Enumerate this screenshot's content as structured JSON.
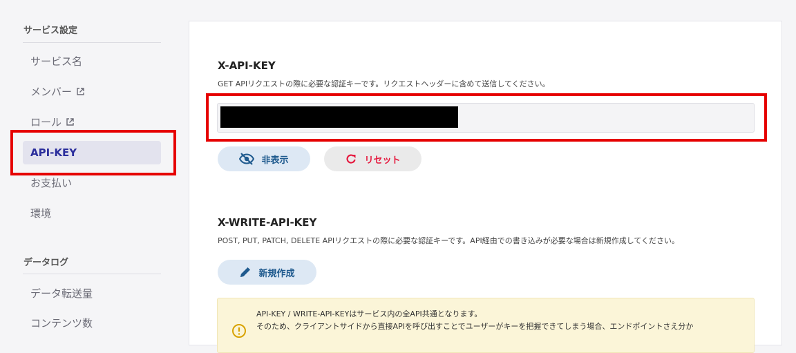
{
  "sidebar": {
    "service_settings_title": "サービス設定",
    "items": [
      {
        "label": "サービス名"
      },
      {
        "label": "メンバー",
        "icon": "external-link-icon"
      },
      {
        "label": "ロール",
        "icon": "external-link-icon"
      },
      {
        "label": "API-KEY",
        "active": true
      },
      {
        "label": "お支払い"
      },
      {
        "label": "環境"
      }
    ],
    "data_log_title": "データログ",
    "data_log_items": [
      {
        "label": "データ転送量"
      },
      {
        "label": "コンテンツ数"
      }
    ]
  },
  "api_key": {
    "title": "X-API-KEY",
    "description": "GET APIリクエストの際に必要な認証キーです。リクエストヘッダーに含めて送信してください。",
    "hide_button": "非表示",
    "reset_button": "リセット"
  },
  "write_api_key": {
    "title": "X-WRITE-API-KEY",
    "description": "POST, PUT, PATCH, DELETE APIリクエストの際に必要な認証キーです。API経由での書き込みが必要な場合は新規作成してください。",
    "create_button": "新規作成"
  },
  "notice": {
    "line1": "API-KEY / WRITE-API-KEYはサービス内の全API共通となります。",
    "line2": "そのため、クライアントサイドから直接APIを呼び出すことでユーザーがキーを把握できてしまう場合、エンドポイントさえ分か"
  },
  "colors": {
    "accent": "#2b2e9c",
    "highlight_box": "#e60000",
    "reset_red": "#e5193e"
  }
}
